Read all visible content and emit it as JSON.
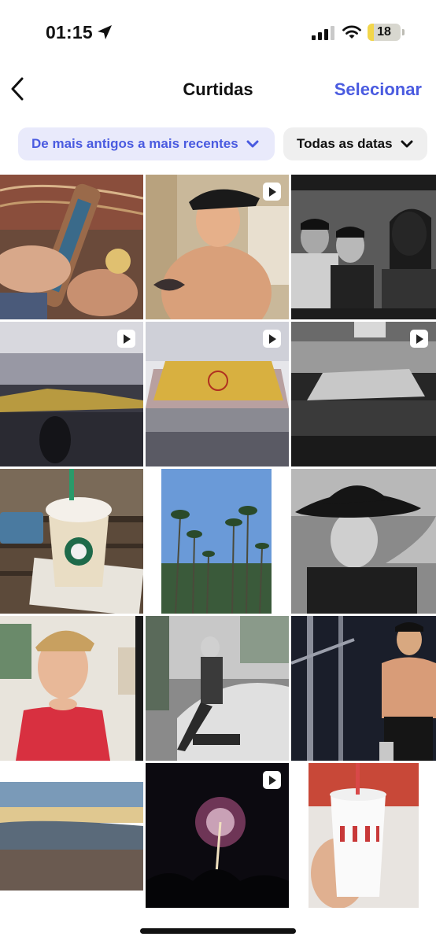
{
  "status_bar": {
    "time": "01:15",
    "battery": "18"
  },
  "nav": {
    "title": "Curtidas",
    "select_label": "Selecionar"
  },
  "filters": {
    "sort_label": "De mais antigos a mais recentes",
    "date_label": "Todas as datas"
  },
  "grid": {
    "items": [
      {
        "kind": "photo",
        "has_video": false,
        "subject": "hands with bracelets at market stall"
      },
      {
        "kind": "photo",
        "has_video": true,
        "subject": "shirtless man in cap smiling"
      },
      {
        "kind": "photo",
        "has_video": false,
        "subject": "three men, black and white selfie"
      },
      {
        "kind": "photo",
        "has_video": true,
        "subject": "arena crowd basketball"
      },
      {
        "kind": "photo",
        "has_video": true,
        "subject": "basketball court arena"
      },
      {
        "kind": "photo",
        "has_video": true,
        "subject": "arena black and white"
      },
      {
        "kind": "photo",
        "has_video": false,
        "subject": "coffee frappuccino on table"
      },
      {
        "kind": "photo",
        "has_video": false,
        "subject": "palm trees against sky"
      },
      {
        "kind": "photo",
        "has_video": false,
        "subject": "man in black hat, black and white"
      },
      {
        "kind": "photo",
        "has_video": false,
        "subject": "young man in red tank top"
      },
      {
        "kind": "photo",
        "has_video": false,
        "subject": "man sitting on car hood"
      },
      {
        "kind": "photo",
        "has_video": false,
        "subject": "shirtless man at night"
      },
      {
        "kind": "photo",
        "has_video": false,
        "subject": "beach sunset"
      },
      {
        "kind": "photo",
        "has_video": true,
        "subject": "fireworks in night sky"
      },
      {
        "kind": "photo",
        "has_video": false,
        "subject": "hand holding drink cup"
      }
    ]
  }
}
